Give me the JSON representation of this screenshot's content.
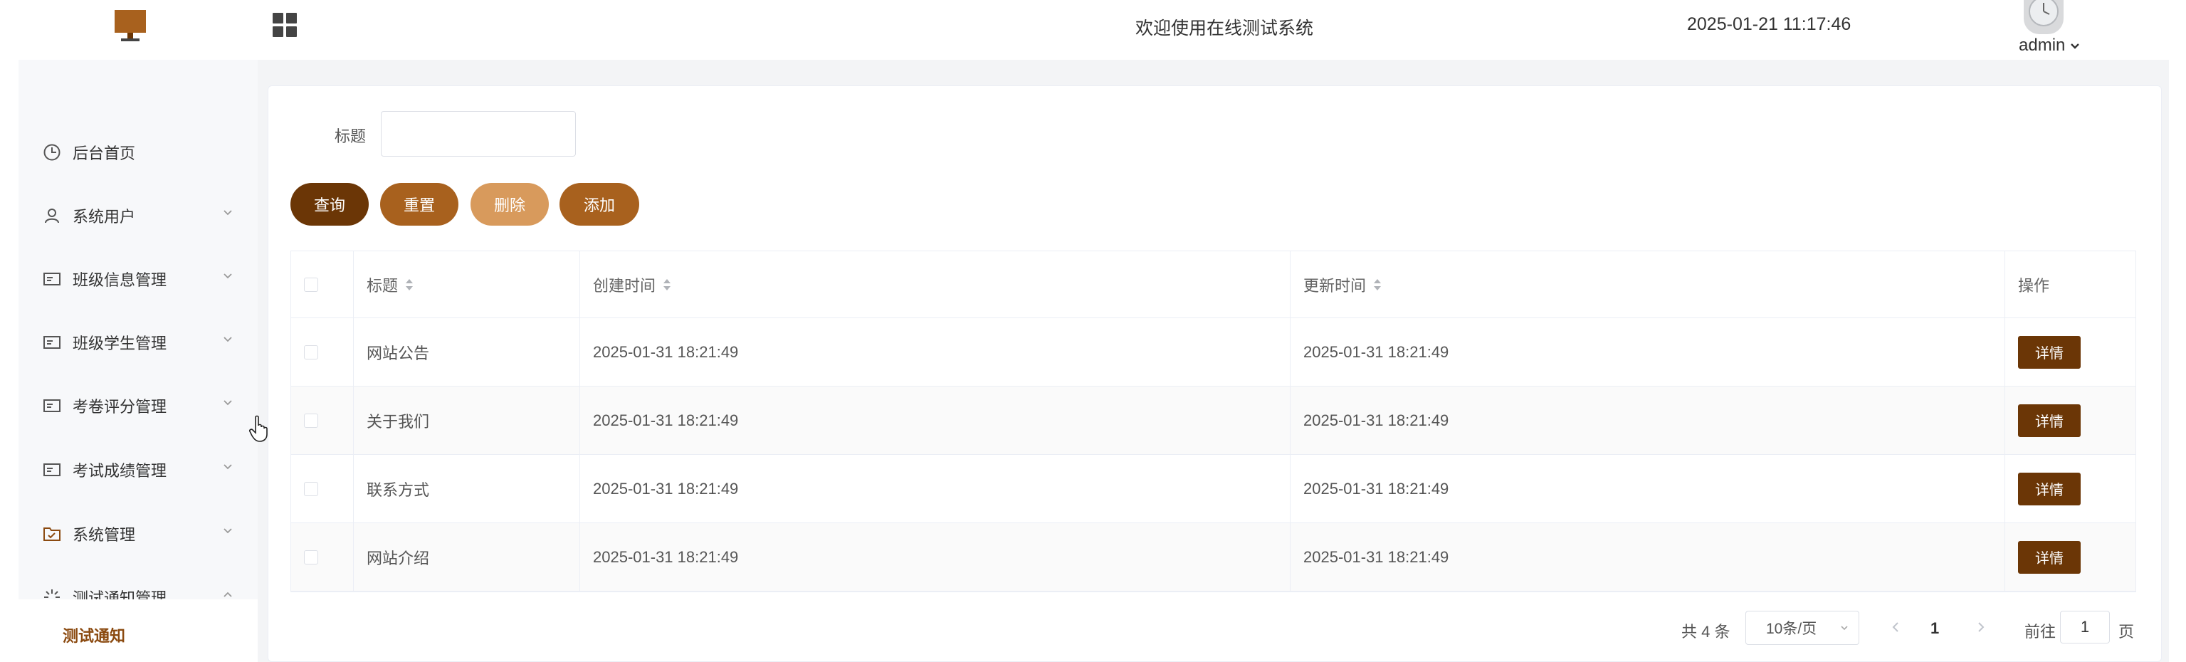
{
  "header": {
    "welcome": "欢迎使用在线测试系统",
    "datetime": "2025-01-21 11:17:46",
    "user": "admin"
  },
  "colors": {
    "accent_dark": "#6b3606",
    "accent": "#a8611e",
    "accent_light": "#d89a5c"
  },
  "sidebar": {
    "items": [
      {
        "label": "后台首页",
        "icon": "dashboard-icon",
        "chevron": ""
      },
      {
        "label": "系统用户",
        "icon": "user-icon",
        "chevron": "down"
      },
      {
        "label": "班级信息管理",
        "icon": "card-icon",
        "chevron": "down"
      },
      {
        "label": "班级学生管理",
        "icon": "card-icon",
        "chevron": "down"
      },
      {
        "label": "考卷评分管理",
        "icon": "card-icon",
        "chevron": "down"
      },
      {
        "label": "考试成绩管理",
        "icon": "card-icon",
        "chevron": "down"
      },
      {
        "label": "系统管理",
        "icon": "folder-icon",
        "chevron": "down"
      },
      {
        "label": "测试通知管理",
        "icon": "sparkle-icon",
        "chevron": "up"
      }
    ],
    "sub_item": "测试通知"
  },
  "filter": {
    "title_label": "标题",
    "title_value": ""
  },
  "buttons": {
    "query": "查询",
    "reset": "重置",
    "delete": "删除",
    "add": "添加"
  },
  "table": {
    "headers": {
      "title": "标题",
      "created": "创建时间",
      "updated": "更新时间",
      "actions": "操作"
    },
    "detail_label": "详情",
    "rows": [
      {
        "title": "网站公告",
        "created": "2025-01-31 18:21:49",
        "updated": "2025-01-31 18:21:49"
      },
      {
        "title": "关于我们",
        "created": "2025-01-31 18:21:49",
        "updated": "2025-01-31 18:21:49"
      },
      {
        "title": "联系方式",
        "created": "2025-01-31 18:21:49",
        "updated": "2025-01-31 18:21:49"
      },
      {
        "title": "网站介绍",
        "created": "2025-01-31 18:21:49",
        "updated": "2025-01-31 18:21:49"
      }
    ]
  },
  "pagination": {
    "total": "共 4 条",
    "page_size": "10条/页",
    "current_page": "1",
    "goto_label": "前往",
    "goto_value": "1",
    "goto_suffix": "页"
  }
}
